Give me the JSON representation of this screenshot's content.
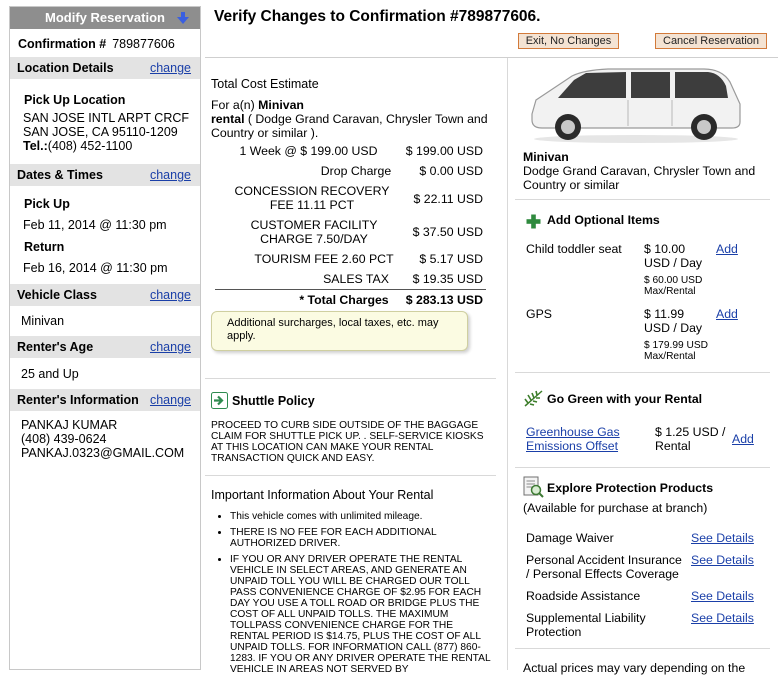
{
  "sidebar": {
    "title": "Modify Reservation",
    "confirmation_label": "Confirmation #",
    "confirmation_number": "789877606",
    "change_label": "change",
    "location": {
      "header": "Location Details",
      "pickup_title": "Pick Up Location",
      "line1": "SAN JOSE INTL ARPT CRCF",
      "line2": "SAN JOSE, CA 95110-1209",
      "tel_label": "Tel.:",
      "tel": "(408) 452-1100"
    },
    "dates": {
      "header": "Dates & Times",
      "pickup_title": "Pick Up",
      "pickup": "Feb 11, 2014 @ 11:30 pm",
      "return_title": "Return",
      "return": "Feb 16, 2014 @ 11:30 pm"
    },
    "vehicle": {
      "header": "Vehicle Class",
      "value": "Minivan"
    },
    "age": {
      "header": "Renter's Age",
      "value": "25 and Up"
    },
    "renter": {
      "header": "Renter's Information",
      "name": "PANKAJ KUMAR",
      "phone": "(408) 439-0624",
      "email": "PANKAJ.0323@GMAIL.COM"
    }
  },
  "header": {
    "title": "Verify Changes to Confirmation #789877606.",
    "exit_button": "Exit, No Changes",
    "cancel_button": "Cancel Reservation"
  },
  "cost": {
    "title": "Total Cost Estimate",
    "for_prefix": "For a(n) ",
    "vehicle_type": "Minivan",
    "rental_label": "rental",
    "vehicle_desc": " ( Dodge Grand Caravan, Chrysler Town and Country or similar ).",
    "rows": [
      {
        "label": "1 Week @ $ 199.00 USD",
        "value": "$ 199.00 USD"
      },
      {
        "label": "Drop Charge",
        "value": "$ 0.00 USD"
      },
      {
        "label": "CONCESSION RECOVERY FEE 11.11 PCT",
        "value": "$ 22.11 USD"
      },
      {
        "label": "CUSTOMER FACILITY CHARGE 7.50/DAY",
        "value": "$ 37.50 USD"
      },
      {
        "label": "TOURISM FEE 2.60 PCT",
        "value": "$ 5.17 USD"
      },
      {
        "label": "SALES TAX",
        "value": "$ 19.35 USD"
      }
    ],
    "total_label": "* Total Charges",
    "total_value": "$ 283.13 USD",
    "note": "Additional surcharges, local taxes, etc. may apply."
  },
  "shuttle": {
    "title": "Shuttle Policy",
    "text": "PROCEED TO CURB SIDE OUTSIDE OF THE BAGGAGE CLAIM FOR SHUTTLE PICK UP. . SELF-SERVICE KIOSKS AT THIS LOCATION CAN MAKE YOUR RENTAL TRANSACTION QUICK AND EASY."
  },
  "important": {
    "title": "Important Information About Your Rental",
    "items": [
      "This vehicle comes with unlimited mileage.",
      "THERE IS NO FEE FOR EACH ADDITIONAL AUTHORIZED DRIVER.",
      "IF YOU OR ANY DRIVER OPERATE THE RENTAL VEHICLE IN SELECT AREAS, AND GENERATE AN UNPAID TOLL YOU WILL BE CHARGED OUR TOLL PASS CONVENIENCE CHARGE OF $2.95 FOR EACH DAY YOU USE A TOLL ROAD OR BRIDGE PLUS THE COST OF ALL UNPAID TOLLS. THE MAXIMUM TOLLPASS CONVENIENCE CHARGE FOR THE RENTAL PERIOD IS $14.75, PLUS THE COST OF ALL UNPAID TOLLS. FOR INFORMATION CALL (877) 860-1283. IF YOU OR ANY DRIVER OPERATE THE RENTAL VEHICLE IN AREAS NOT SERVED BY"
    ]
  },
  "vehicle_card": {
    "name": "Minivan",
    "desc": "Dodge Grand Caravan, Chrysler Town and Country or similar"
  },
  "optional": {
    "title": "Add Optional Items",
    "add_label": "Add",
    "items": [
      {
        "name": "Child toddler seat",
        "price": "$ 10.00 USD / Day",
        "max": "$ 60.00 USD Max/Rental"
      },
      {
        "name": "GPS",
        "price": "$ 11.99 USD / Day",
        "max": "$ 179.99 USD Max/Rental"
      }
    ]
  },
  "green": {
    "title": "Go Green with your Rental",
    "item": "Greenhouse Gas Emissions Offset",
    "price": "$ 1.25 USD / Rental",
    "add_label": "Add"
  },
  "protection": {
    "title": "Explore Protection Products",
    "subtitle": "(Available for purchase at branch)",
    "details_label": "See Details",
    "items": [
      "Damage Waiver",
      "Personal Accident Insurance / Personal Effects Coverage",
      "Roadside Assistance",
      "Supplemental Liability Protection"
    ],
    "footer": "Actual prices may vary depending on the"
  },
  "colors": {
    "link": "#1a3fa8",
    "sidebar_header": "#8e8e8e",
    "section_bar": "#e3e3e3",
    "button_border": "#d27a3a"
  }
}
